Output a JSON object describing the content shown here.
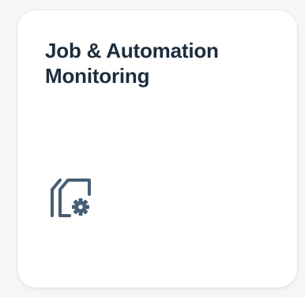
{
  "tile": {
    "title": "Job & Automation Monitoring",
    "icon": "job-automation-monitoring-icon"
  },
  "colors": {
    "background": "#f5f6f7",
    "tile_background": "#ffffff",
    "title_text": "#1d2d3e",
    "icon": "#475e75"
  }
}
